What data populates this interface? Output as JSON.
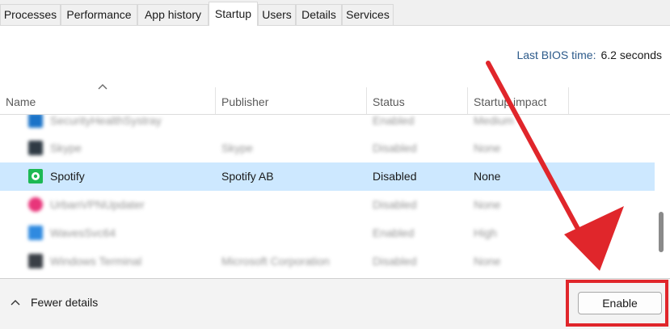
{
  "tabs": [
    {
      "label": "Processes",
      "active": false
    },
    {
      "label": "Performance",
      "active": false
    },
    {
      "label": "App history",
      "active": false
    },
    {
      "label": "Startup",
      "active": true
    },
    {
      "label": "Users",
      "active": false
    },
    {
      "label": "Details",
      "active": false
    },
    {
      "label": "Services",
      "active": false
    }
  ],
  "bios": {
    "label": "Last BIOS time:",
    "value": "6.2 seconds"
  },
  "columns": {
    "name": "Name",
    "publisher": "Publisher",
    "status": "Status",
    "impact": "Startup impact"
  },
  "rows": [
    {
      "name": "SecurityHealthSystray",
      "publisher": "",
      "status": "Enabled",
      "impact": "Medium",
      "icon": "shield-app-icon",
      "icon_color": "#1a73c8",
      "selected": false,
      "blurred": true
    },
    {
      "name": "Skype",
      "publisher": "Skype",
      "status": "Disabled",
      "impact": "None",
      "icon": "skype-icon",
      "icon_color": "#2f3a44",
      "selected": false,
      "blurred": true
    },
    {
      "name": "Spotify",
      "publisher": "Spotify AB",
      "status": "Disabled",
      "impact": "None",
      "icon": "spotify-icon",
      "icon_color": "#1db954",
      "selected": true,
      "blurred": false
    },
    {
      "name": "UrbanVPNUpdater",
      "publisher": "",
      "status": "Disabled",
      "impact": "None",
      "icon": "vpn-icon",
      "icon_color": "#e8357a",
      "selected": false,
      "blurred": true
    },
    {
      "name": "WavesSvc64",
      "publisher": "",
      "status": "Enabled",
      "impact": "High",
      "icon": "waves-icon",
      "icon_color": "#2f8ae0",
      "selected": false,
      "blurred": true
    },
    {
      "name": "Windows Terminal",
      "publisher": "Microsoft Corporation",
      "status": "Disabled",
      "impact": "None",
      "icon": "terminal-icon",
      "icon_color": "#3a3f46",
      "selected": false,
      "blurred": true
    }
  ],
  "footer": {
    "fewer_details": "Fewer details",
    "enable_button": "Enable"
  },
  "colors": {
    "selected_row": "#cde8ff",
    "annotation": "#e0262b"
  }
}
